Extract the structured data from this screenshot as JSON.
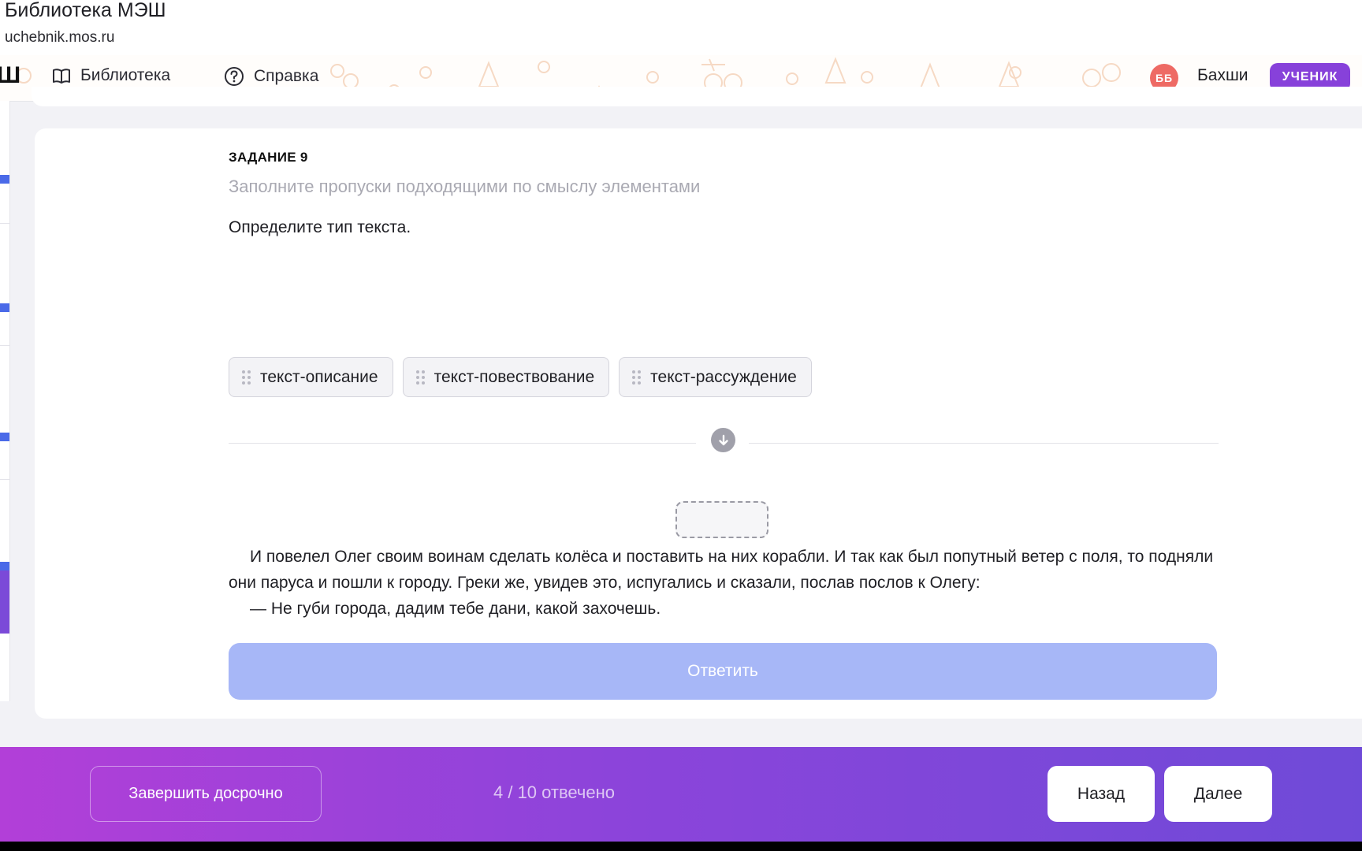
{
  "window": {
    "title": "Библиотека МЭШ",
    "url": "uchebnik.mos.ru"
  },
  "nav": {
    "logo": "Ш",
    "library": "Библиотека",
    "help": "Справка",
    "avatar_initials": "ББ",
    "user_name": "Бахши",
    "role_badge": "УЧЕНИК"
  },
  "task": {
    "number_label": "ЗАДАНИЕ 9",
    "instruction": "Заполните пропуски подходящими по смыслу элементами",
    "question": "Определите тип текста.",
    "options": [
      "текст-описание",
      "текст-повествование",
      "текст-рассуждение"
    ],
    "text_paragraphs": [
      "И повелел Олег своим воинам сделать колёса и поставить на них корабли. И так как был попутный ветер с поля, то подняли они паруса и пошли к городу. Греки же, увидев это, испугались и сказали, послав послов к Олегу:",
      "— Не губи города, дадим тебе дани, какой захочешь."
    ],
    "answer_button": "Ответить"
  },
  "footer": {
    "finish_button": "Завершить досрочно",
    "progress": "4 / 10 отвечено",
    "back_button": "Назад",
    "next_button": "Далее"
  },
  "colors": {
    "accent_purple": "#8741da",
    "avatar_red": "#ee6a64",
    "answer_disabled": "#a7b7f7",
    "footer_gradient_start": "#b23fd8",
    "footer_gradient_end": "#6f4ad8"
  },
  "icons": {
    "library": "open-book-icon",
    "help": "question-circle-icon",
    "drag": "drag-handle-icon",
    "divider": "arrow-down-circle-icon"
  }
}
